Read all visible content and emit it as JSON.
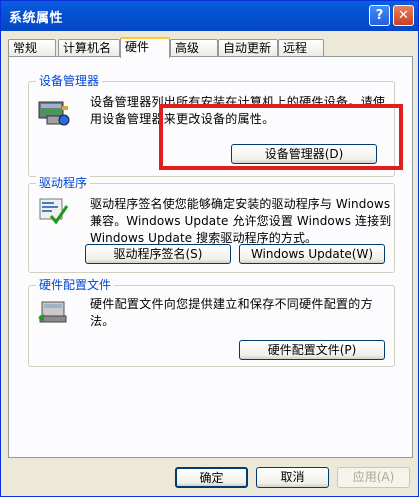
{
  "window": {
    "title": "系统属性"
  },
  "titlebar_buttons": {
    "help": "?",
    "close": "✕"
  },
  "tabs": [
    "常规",
    "计算机名",
    "硬件",
    "高级",
    "自动更新",
    "远程"
  ],
  "active_tab": "硬件",
  "device_manager": {
    "title": "设备管理器",
    "description_line1": "设备管理器列出所有安装在计算机上的硬件设备。请使",
    "description_line2": "用设备管理器来更改设备的属性。",
    "button_label": "设备管理器(D)"
  },
  "driver": {
    "title": "驱动程序",
    "description_line1": "驱动程序签名使您能够确定安装的驱动程序与 Windows",
    "description_line2": "兼容。Windows Update 允许您设置 Windows 连接到",
    "description_line3": "Windows Update 搜索驱动程序的方式。",
    "signing_button": "驱动程序签名(S)",
    "update_button": "Windows Update(W)"
  },
  "hardware_profiles": {
    "title": "硬件配置文件",
    "description_line1": "硬件配置文件向您提供建立和保存不同硬件配置的方",
    "description_line2": "法。",
    "button_label": "硬件配置文件(P)"
  },
  "footer": {
    "ok": "确定",
    "cancel": "取消",
    "apply": "应用(A)"
  }
}
